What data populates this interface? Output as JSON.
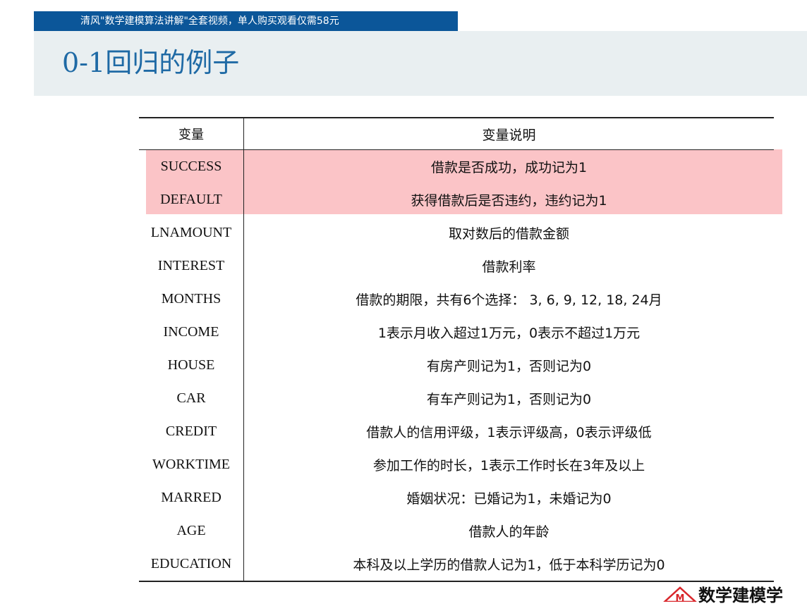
{
  "banner": {
    "text": "清风\"数学建模算法讲解\"全套视频，单人购买观看仅需58元"
  },
  "slide": {
    "title": "0-1回归的例子"
  },
  "table": {
    "headers": [
      "变量",
      "变量说明"
    ],
    "rows": [
      {
        "var": "SUCCESS",
        "desc": "借款是否成功，成功记为1",
        "highlighted": true
      },
      {
        "var": "DEFAULT",
        "desc": "获得借款后是否违约，违约记为1",
        "highlighted": true
      },
      {
        "var": "LNAMOUNT",
        "desc": "取对数后的借款金额"
      },
      {
        "var": "INTEREST",
        "desc": "借款利率"
      },
      {
        "var": "MONTHS",
        "desc": "借款的期限，共有6个选择： 3, 6, 9, 12, 18, 24月"
      },
      {
        "var": "INCOME",
        "desc": "1表示月收入超过1万元，0表示不超过1万元"
      },
      {
        "var": "HOUSE",
        "desc": "有房产则记为1，否则记为0"
      },
      {
        "var": "CAR",
        "desc": "有车产则记为1，否则记为0"
      },
      {
        "var": "CREDIT",
        "desc": "借款人的信用评级，1表示评级高，0表示评级低"
      },
      {
        "var": "WORKTIME",
        "desc": "参加工作的时长，1表示工作时长在3年及以上"
      },
      {
        "var": "MARRED",
        "desc": "婚姻状况：已婚记为1，未婚记为0"
      },
      {
        "var": "AGE",
        "desc": "借款人的年龄"
      },
      {
        "var": "EDUCATION",
        "desc": "本科及以上学历的借款人记为1，低于本科学历记为0"
      }
    ]
  },
  "logo": {
    "text": "数学建模学",
    "mark_letter": "M",
    "icon": "logo-m-icon"
  },
  "colors": {
    "banner_bg": "#0b5699",
    "title": "#1f6aa5",
    "header_band": "#e9eff1",
    "highlight": "#fbc4c7",
    "logo_red": "#d9262b"
  }
}
